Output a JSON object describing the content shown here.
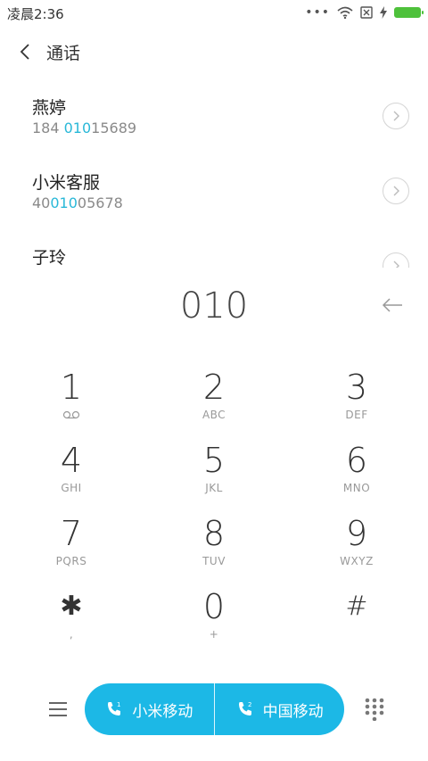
{
  "status_bar": {
    "time": "凌晨2:36",
    "battery_color": "#4ec13b"
  },
  "header": {
    "title": "通话",
    "back_icon": "chevron-left-icon"
  },
  "contacts": [
    {
      "name": "燕婷",
      "number_pre": "184 ",
      "number_hl": "010",
      "number_post": "15689"
    },
    {
      "name": "小米客服",
      "number_pre": "40",
      "number_hl": "010",
      "number_post": "05678"
    },
    {
      "name": "子玲",
      "number_pre": "",
      "number_hl": "",
      "number_post": ""
    }
  ],
  "dial": {
    "number": "010",
    "delete_icon": "backspace-arrow-icon"
  },
  "keypad": [
    {
      "digit": "1",
      "letters": ""
    },
    {
      "digit": "2",
      "letters": "ABC"
    },
    {
      "digit": "3",
      "letters": "DEF"
    },
    {
      "digit": "4",
      "letters": "GHI"
    },
    {
      "digit": "5",
      "letters": "JKL"
    },
    {
      "digit": "6",
      "letters": "MNO"
    },
    {
      "digit": "7",
      "letters": "PQRS"
    },
    {
      "digit": "8",
      "letters": "TUV"
    },
    {
      "digit": "9",
      "letters": "WXYZ"
    },
    {
      "digit": "✱",
      "letters": ","
    },
    {
      "digit": "0",
      "letters": "+"
    },
    {
      "digit": "#",
      "letters": ""
    }
  ],
  "bottom_bar": {
    "sim1_label": "小米移动",
    "sim2_label": "中国移动",
    "accent_color": "#1cb8e6"
  }
}
